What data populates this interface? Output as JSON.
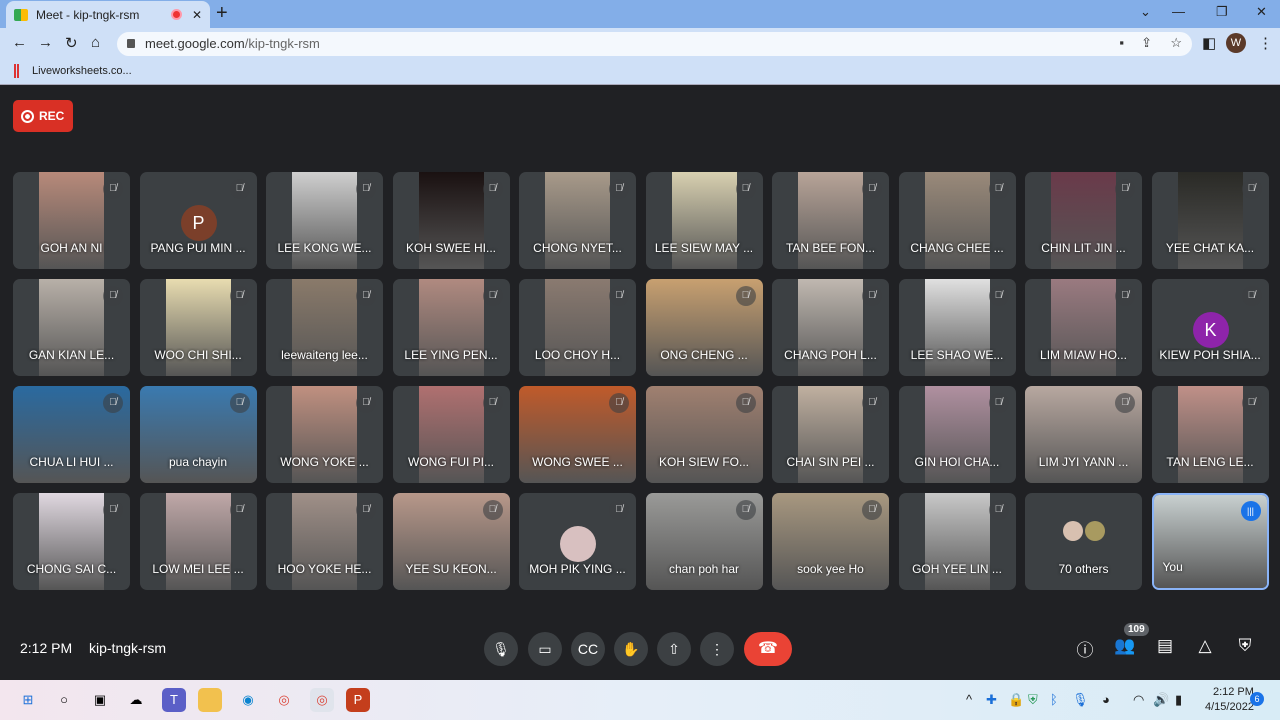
{
  "browser": {
    "tab_title": "Meet - kip-tngk-rsm",
    "url_domain": "meet.google.com",
    "url_path": "/kip-tngk-rsm",
    "bookmark": "Liveworksheets.co...",
    "profile_initial": "W"
  },
  "rec_label": "REC",
  "participants": [
    {
      "name": "GOH AN NI",
      "bg": "#b88a7a"
    },
    {
      "name": "PANG PUI MIN ...",
      "avatar": "P",
      "avatar_color": "#7b3f2a"
    },
    {
      "name": "LEE KONG WE...",
      "bg": "#cfcfcf"
    },
    {
      "name": "KOH SWEE HI...",
      "bg": "#1a1111"
    },
    {
      "name": "CHONG NYET...",
      "bg": "#a89a8a"
    },
    {
      "name": "LEE SIEW MAY ...",
      "bg": "#d8d0b0"
    },
    {
      "name": "TAN BEE FON...",
      "bg": "#b8a498"
    },
    {
      "name": "CHANG CHEE ...",
      "bg": "#9a8a7a"
    },
    {
      "name": "CHIN LIT JIN ...",
      "bg": "#6a3a4a"
    },
    {
      "name": "YEE CHAT KA...",
      "bg": "#2a2a26"
    },
    {
      "name": "GAN KIAN LE...",
      "bg": "#b8b0a8"
    },
    {
      "name": "WOO CHI SHI...",
      "bg": "#e8dcb0"
    },
    {
      "name": "leewaiteng lee...",
      "bg": "#8a7a6a"
    },
    {
      "name": "LEE YING PEN...",
      "bg": "#b08a80"
    },
    {
      "name": "LOO CHOY H...",
      "bg": "#8a7a70"
    },
    {
      "name": "ONG CHENG ...",
      "bg": "#c8a070",
      "full": true
    },
    {
      "name": "CHANG POH L...",
      "bg": "#c0b8b0"
    },
    {
      "name": "LEE SHAO WE...",
      "bg": "#e0e0e0"
    },
    {
      "name": "LIM MIAW HO...",
      "bg": "#9a7a80"
    },
    {
      "name": "KIEW POH SHIA...",
      "avatar": "K",
      "avatar_color": "#8e24aa"
    },
    {
      "name": "CHUA LI HUI ...",
      "bg": "#2a6aa0",
      "full": true
    },
    {
      "name": "pua chayin",
      "bg": "#3a7ab0",
      "full": true
    },
    {
      "name": "WONG YOKE ...",
      "bg": "#c09080"
    },
    {
      "name": "WONG FUI PI...",
      "bg": "#b07070"
    },
    {
      "name": "WONG SWEE ...",
      "bg": "#c05a2a",
      "full": true
    },
    {
      "name": "KOH SIEW FO...",
      "bg": "#a08070",
      "full": true
    },
    {
      "name": "CHAI SIN PEI ...",
      "bg": "#c0b0a0"
    },
    {
      "name": "GIN HOI CHA...",
      "bg": "#b090a0"
    },
    {
      "name": "LIM JYI YANN ...",
      "bg": "#b8a8a0",
      "full": true
    },
    {
      "name": "TAN LENG LE...",
      "bg": "#c09088"
    },
    {
      "name": "CHONG SAI C...",
      "bg": "#e0d8e0"
    },
    {
      "name": "LOW MEI LEE ...",
      "bg": "#c0a8a8"
    },
    {
      "name": "HOO YOKE HE...",
      "bg": "#a09088"
    },
    {
      "name": "YEE SU KEON...",
      "bg": "#b8988a",
      "full": true
    },
    {
      "name": "MOH PIK YING ...",
      "avatar": "",
      "avatar_color": "#d8c0c0"
    },
    {
      "name": "chan poh har",
      "bg": "#9a9a98",
      "full": true
    },
    {
      "name": "sook yee Ho",
      "bg": "#a89880",
      "full": true
    },
    {
      "name": "GOH YEE LIN ...",
      "bg": "#c8c8c8"
    },
    {
      "name": "70 others",
      "others": true
    },
    {
      "name": "You",
      "bg": "#c8d0d0",
      "full": true,
      "me": true
    }
  ],
  "bottom": {
    "time": "2:12 PM",
    "meeting_code": "kip-tngk-rsm",
    "people_count": "109"
  },
  "taskbar": {
    "time": "2:12 PM",
    "date": "4/15/2022",
    "notifications": "6"
  }
}
